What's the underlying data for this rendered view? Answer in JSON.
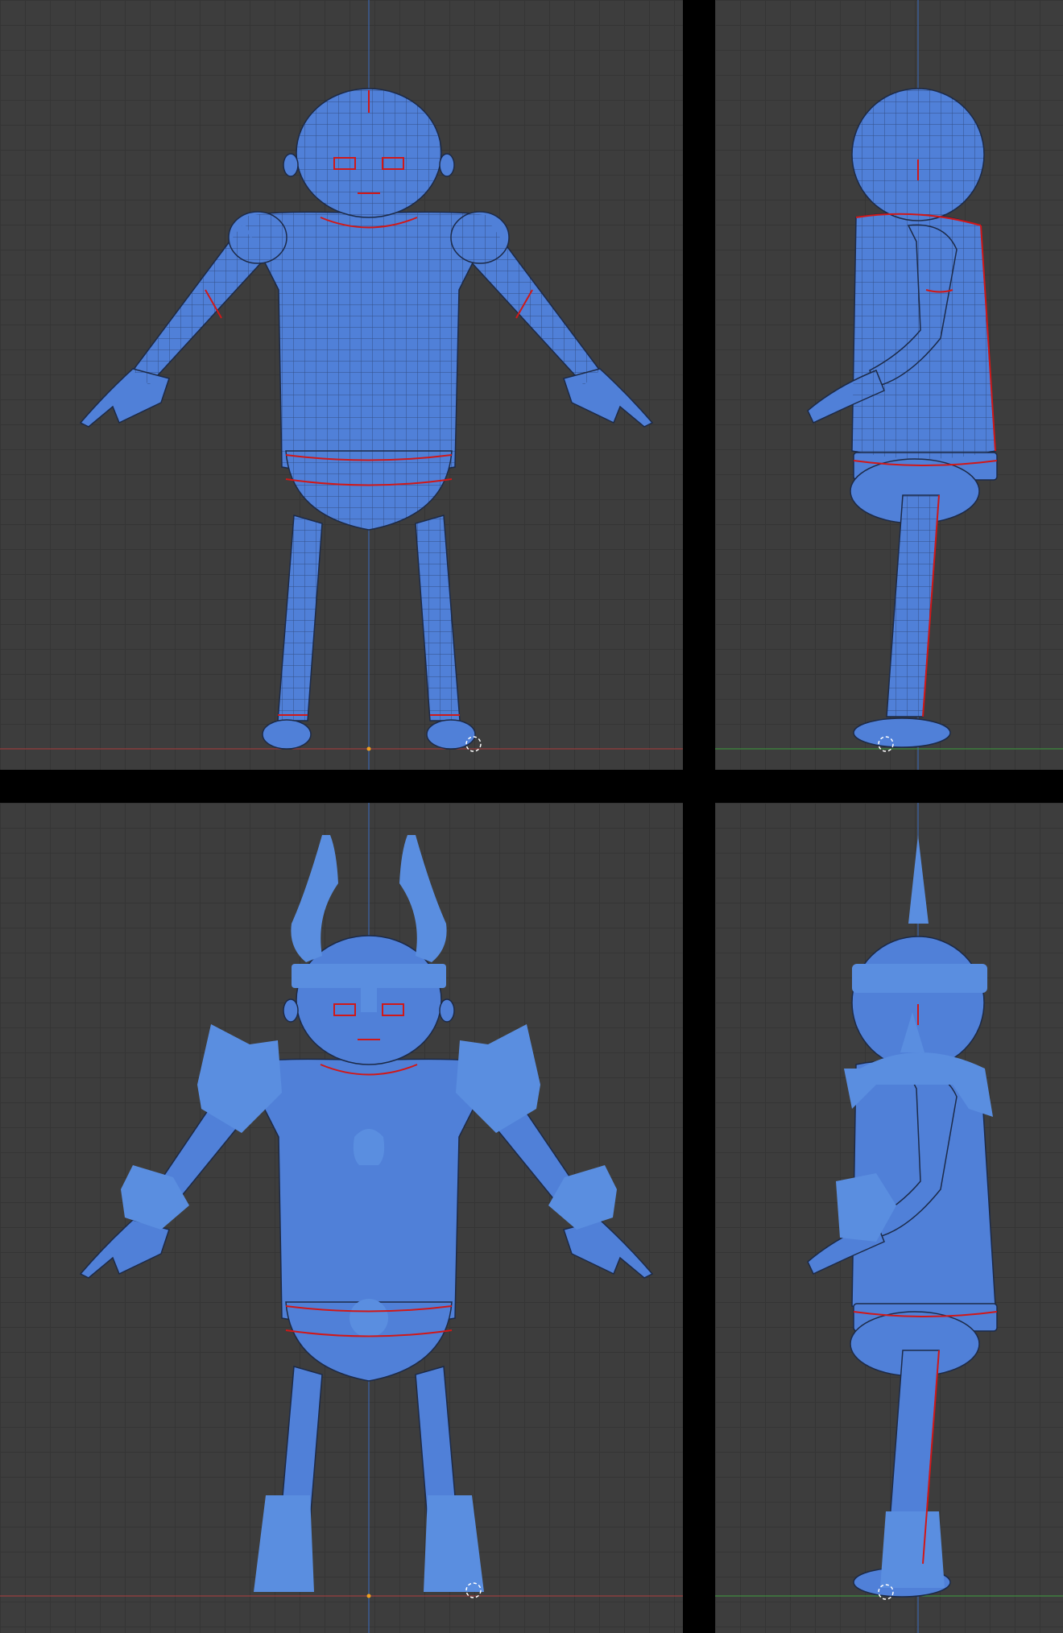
{
  "viewports": [
    {
      "view": "front",
      "model": "base-character"
    },
    {
      "view": "side",
      "model": "base-character"
    },
    {
      "view": "front",
      "model": "armored-character"
    },
    {
      "view": "side",
      "model": "armored-character"
    }
  ],
  "colors": {
    "background": "#3d3d3d",
    "grid": "#353535",
    "mesh_fill": "#5080d8",
    "mesh_wire": "#1c2a48",
    "seam": "#d01818",
    "x_axis": "#b04040",
    "y_axis": "#40a040",
    "z_axis": "#3a6cc0",
    "divider": "#000000",
    "cursor": "#ffffff",
    "origin": "#f0a020"
  }
}
